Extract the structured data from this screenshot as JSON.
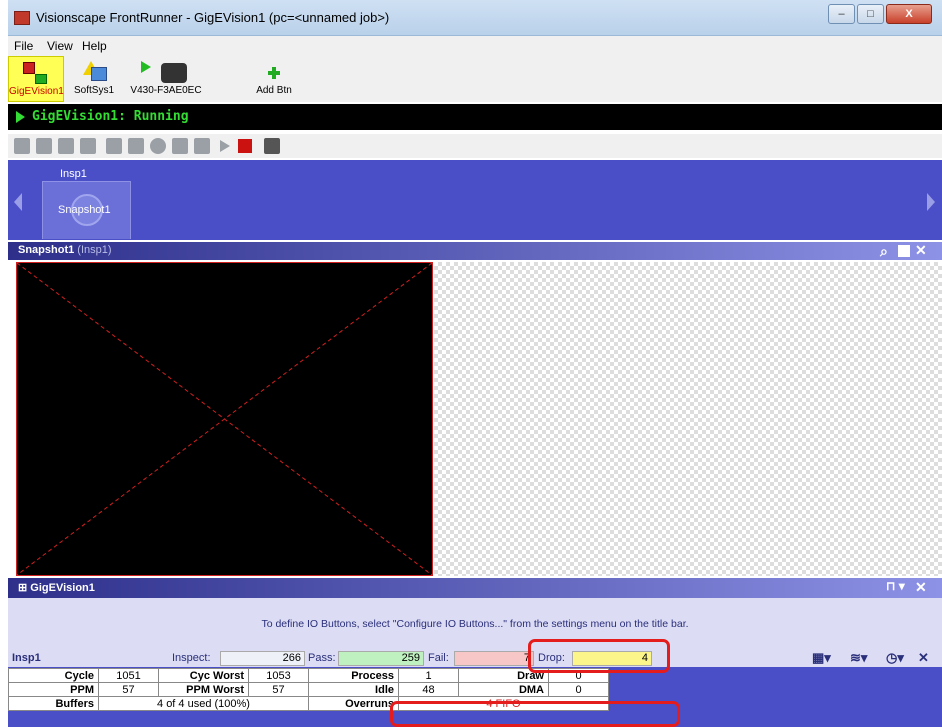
{
  "window": {
    "title": "Visionscape FrontRunner - GigEVision1 (pc=<unnamed job>)",
    "min": "–",
    "max": "□",
    "close": "X"
  },
  "menu": [
    "File",
    "View",
    "Help"
  ],
  "devices": [
    {
      "label": "GigEVision1",
      "icon": "camera-device-icon"
    },
    {
      "label": "SoftSys1",
      "icon": "softsys-warning-icon"
    },
    {
      "label": "V430-F3AE0EC",
      "icon": "v430-camera-icon"
    },
    {
      "label": "Add Btn",
      "icon": "add-icon"
    }
  ],
  "status": {
    "text": "GigEVision1: Running",
    "color": "#33dd33"
  },
  "inspection": {
    "name": "Insp1",
    "snapshot": "Snapshot1"
  },
  "view": {
    "title": "Snapshot1",
    "subtitle": "(Insp1)"
  },
  "io": {
    "title": "GigEVision1",
    "message": "To define IO Buttons, select \"Configure IO Buttons...\" from the settings menu on the title bar."
  },
  "insp_bar": {
    "name": "Insp1",
    "inspect_label": "Inspect:",
    "inspect_value": "266",
    "pass_label": "Pass:",
    "pass_value": "259",
    "fail_label": "Fail:",
    "fail_value": "7",
    "drop_label": "Drop:",
    "drop_value": "4"
  },
  "stats": {
    "cycle_label": "Cycle",
    "cycle": "1051",
    "cyc_worst_label": "Cyc Worst",
    "cyc_worst": "1053",
    "process_label": "Process",
    "process": "1",
    "draw_label": "Draw",
    "draw": "0",
    "ppm_label": "PPM",
    "ppm": "57",
    "ppm_worst_label": "PPM Worst",
    "ppm_worst": "57",
    "idle_label": "Idle",
    "idle": "48",
    "dma_label": "DMA",
    "dma": "0",
    "buffers_label": "Buffers",
    "buffers": "4 of 4 used (100%)",
    "overruns_label": "Overruns",
    "overruns": "4 FIFO"
  },
  "colors": {
    "panel": "#4a4fc8",
    "highlight": "#e41c1c",
    "pass": "#bff0bf",
    "fail": "#f7c6c6",
    "drop": "#fbf58a"
  }
}
